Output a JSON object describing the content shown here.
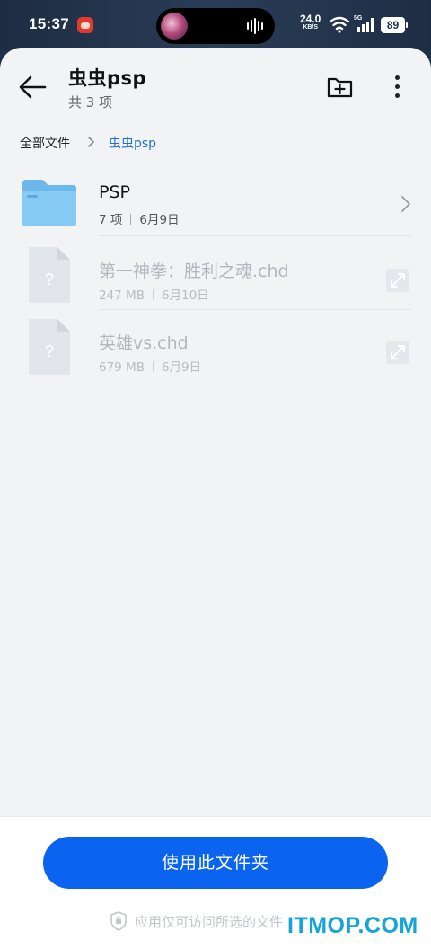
{
  "status_bar": {
    "time": "15:37",
    "net_speed": "24.0",
    "net_unit": "KB/S",
    "signal_label": "5G",
    "battery": "89"
  },
  "header": {
    "title": "虫虫psp",
    "subtitle": "共 3 项"
  },
  "breadcrumb": {
    "root": "全部文件",
    "current": "虫虫psp"
  },
  "files": [
    {
      "name": "PSP",
      "count": "7 项",
      "date": "6月9日",
      "type": "folder",
      "enabled": true
    },
    {
      "name": "第一神拳：胜利之魂.chd",
      "size": "247 MB",
      "date": "6月10日",
      "type": "file",
      "enabled": false
    },
    {
      "name": "英雄vs.chd",
      "size": "679 MB",
      "date": "6月9日",
      "type": "file",
      "enabled": false
    }
  ],
  "actions": {
    "use_folder": "使用此文件夹",
    "privacy_note": "应用仅可访问所选的文件"
  },
  "watermark": "ITMOP.COM",
  "colors": {
    "accent": "#0a64f0",
    "link": "#1f6fd6",
    "folder": "#7ec3ef",
    "background": "#f1f3f5"
  }
}
